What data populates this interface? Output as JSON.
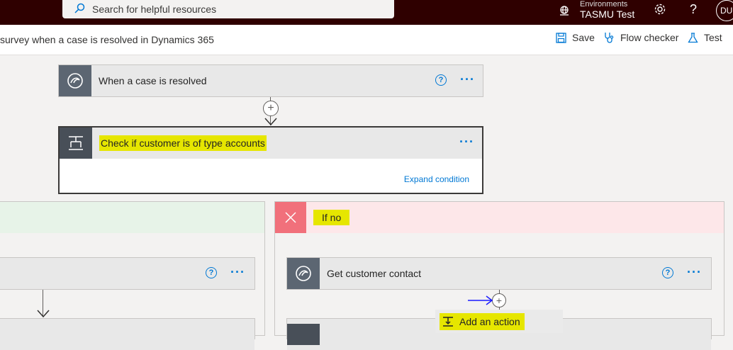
{
  "topbar": {
    "search_placeholder": "Search for helpful resources",
    "env_label": "Environments",
    "env_name": "TASMU Test",
    "avatar_initials": "DU",
    "help_label": "?"
  },
  "cmdbar": {
    "flow_title": "survey when a case is resolved in Dynamics 365",
    "save": "Save",
    "flow_checker": "Flow checker",
    "test": "Test"
  },
  "trigger": {
    "title": "When a case is resolved",
    "help": "?",
    "more": "···"
  },
  "condition": {
    "title": "Check if customer is of type accounts",
    "more": "···",
    "expand_link": "Expand condition"
  },
  "branch_no": {
    "label": "If no",
    "action_title": "Get customer contact",
    "help": "?",
    "more": "···"
  },
  "branch_yes": {
    "help": "?",
    "more": "···"
  },
  "add_action": {
    "label": "Add an action"
  },
  "colors": {
    "topbar": "#2f0000",
    "accent": "#0078d4",
    "dynamics_badge": "#5c6672",
    "condition_badge": "#484f58",
    "no_branch_bg": "#fde7e9",
    "no_branch_badge": "#f1707b",
    "yes_branch_bg": "#e7f3e8",
    "highlight": "#e6e600"
  }
}
